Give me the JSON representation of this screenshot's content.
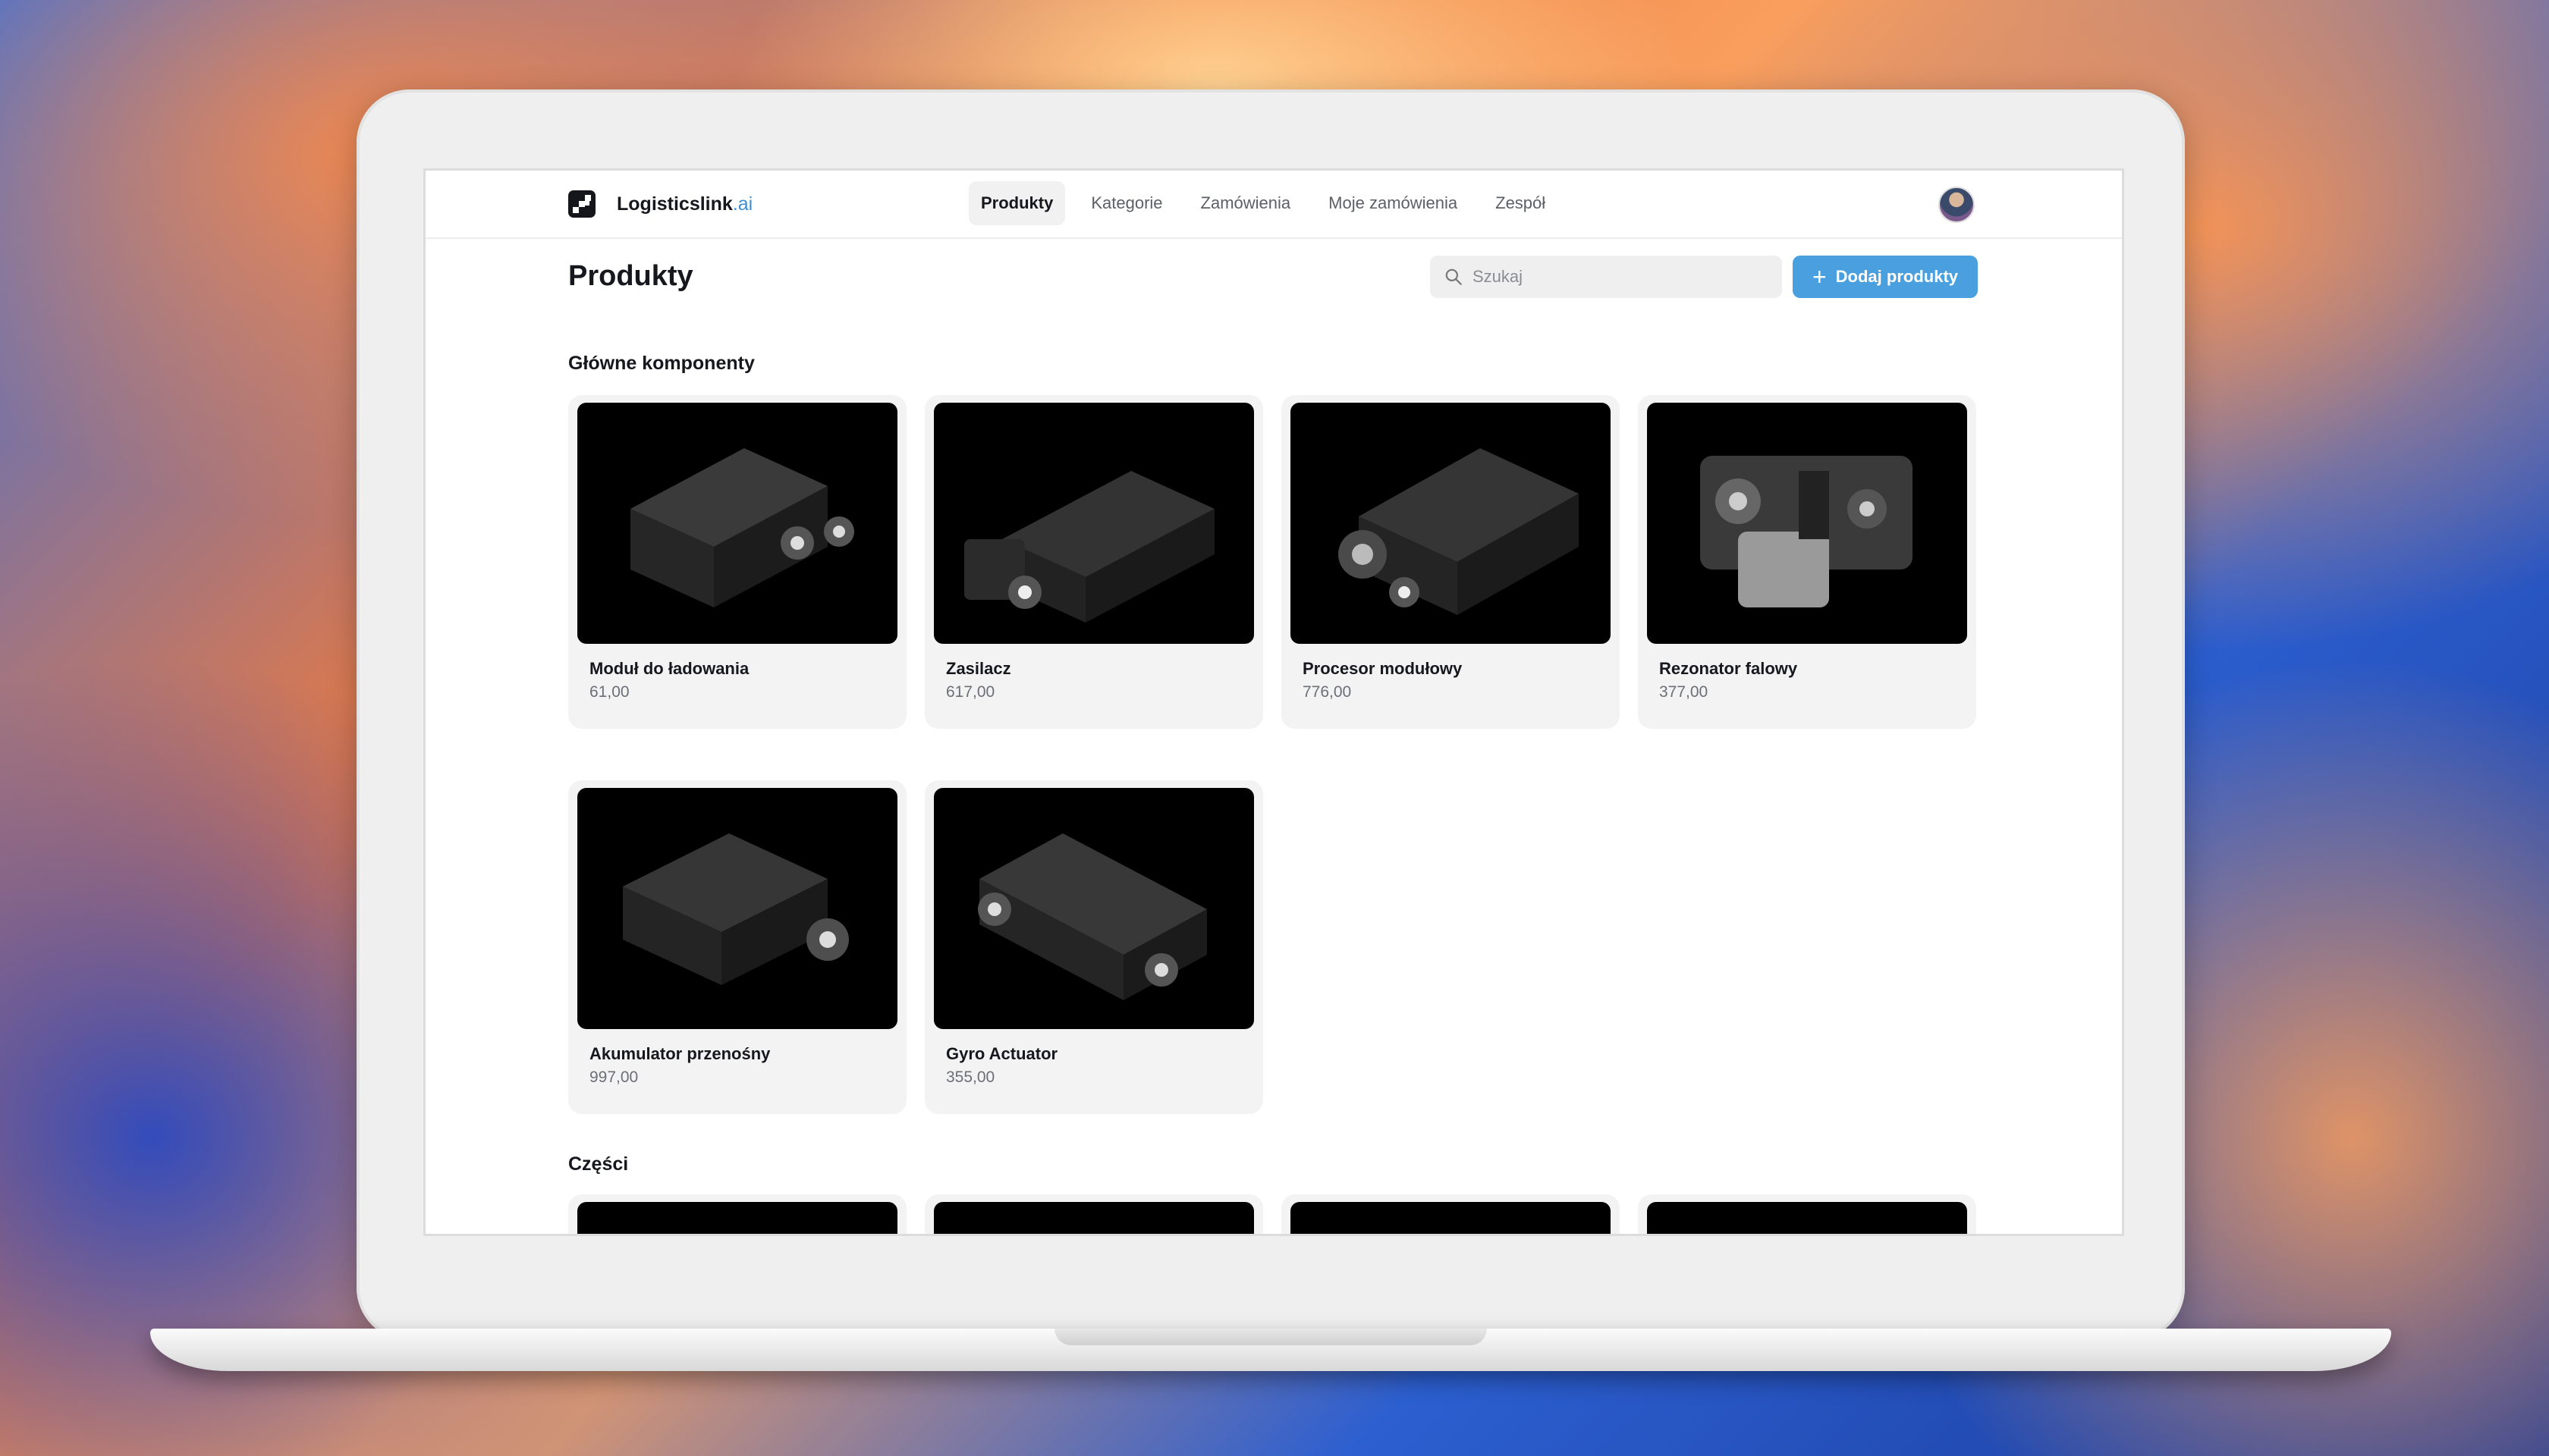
{
  "brand": {
    "name": "Logisticslink",
    "suffix": ".ai"
  },
  "nav": {
    "items": [
      {
        "label": "Produkty",
        "active": true
      },
      {
        "label": "Kategorie",
        "active": false
      },
      {
        "label": "Zamówienia",
        "active": false
      },
      {
        "label": "Moje zamówienia",
        "active": false
      },
      {
        "label": "Zespół",
        "active": false
      }
    ]
  },
  "page": {
    "title": "Produkty"
  },
  "search": {
    "placeholder": "Szukaj",
    "value": ""
  },
  "add_button": {
    "label": "Dodaj produkty"
  },
  "sections": [
    {
      "title": "Główne komponenty",
      "products": [
        {
          "name": "Moduł do ładowania",
          "price": "61,00"
        },
        {
          "name": "Zasilacz",
          "price": "617,00"
        },
        {
          "name": "Procesor modułowy",
          "price": "776,00"
        },
        {
          "name": "Rezonator falowy",
          "price": "377,00"
        },
        {
          "name": "Akumulator przenośny",
          "price": "997,00"
        },
        {
          "name": "Gyro Actuator",
          "price": "355,00"
        }
      ]
    },
    {
      "title": "Części",
      "products": [
        {
          "name": "",
          "price": ""
        },
        {
          "name": "",
          "price": ""
        },
        {
          "name": "",
          "price": ""
        },
        {
          "name": "",
          "price": ""
        }
      ]
    }
  ],
  "colors": {
    "accent": "#4aa0df",
    "brand_suffix": "#3f8fd6",
    "card_bg": "#f3f3f3",
    "image_bg": "#000000"
  },
  "icons": {
    "search": "search-icon",
    "plus": "plus-icon",
    "logo": "logo-icon"
  }
}
